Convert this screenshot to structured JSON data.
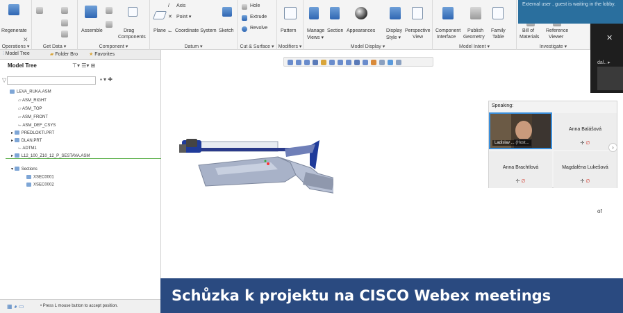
{
  "ribbon": {
    "groups": [
      {
        "label": "Operations ▾"
      },
      {
        "label": "Get Data ▾"
      },
      {
        "label": "Component ▾"
      },
      {
        "label": "Datum ▾"
      },
      {
        "label": "Cut & Surface ▾"
      },
      {
        "label": "Modifiers ▾"
      },
      {
        "label": "Model Display ▾"
      },
      {
        "label": "Model Intent ▾"
      },
      {
        "label": "Investigate ▾"
      }
    ],
    "buttons": {
      "regenerate": "Regenerate",
      "assemble": "Assemble",
      "drag_components_1": "Drag",
      "drag_components_2": "Components",
      "plane": "Plane",
      "axis": "Axis",
      "point": "Point ▾",
      "coordinate_system": "Coordinate System",
      "sketch": "Sketch",
      "hole": "Hole",
      "extrude": "Extrude",
      "revolve": "Revolve",
      "pattern": "Pattern",
      "manage_views_1": "Manage",
      "manage_views_2": "Views ▾",
      "section": "Section",
      "appearances": "Appearances",
      "display_style_1": "Display",
      "display_style_2": "Style ▾",
      "perspective_view_1": "Perspective",
      "perspective_view_2": "View",
      "component_interface_1": "Component",
      "component_interface_2": "Interface",
      "publish_geometry_1": "Publish",
      "publish_geometry_2": "Geometry",
      "family_table_1": "Family",
      "family_table_2": "Table",
      "bill_of_materials_1": "Bill of",
      "bill_of_materials_2": "Materials",
      "reference_viewer_1": "Reference",
      "reference_viewer_2": "Viewer"
    }
  },
  "notification": {
    "text": "External user , guest is waiting in the lobby."
  },
  "left_panel": {
    "tabs": {
      "model_tree": "Model Tree",
      "folder_browser": "Folder Bro",
      "favorites": "Favorites"
    },
    "header": "Model Tree",
    "tree": [
      {
        "label": "LEVA_RUKA.ASM"
      },
      {
        "label": "ASM_RIGHT"
      },
      {
        "label": "ASM_TOP"
      },
      {
        "label": "ASM_FRONT"
      },
      {
        "label": "ASM_DEF_CSYS"
      },
      {
        "label": "PREDLOKTI.PRT"
      },
      {
        "label": "DLAN.PRT"
      },
      {
        "label": "ADTM1"
      },
      {
        "label": "L12_100_Z10_12_P_SESTAVA.ASM"
      },
      {
        "label": "Sections"
      },
      {
        "label": "XSEC0001"
      },
      {
        "label": "XSEC0002"
      }
    ],
    "status": "• Press L mouse button to accept position."
  },
  "webex": {
    "speaking_label": "Speaking:",
    "active_speaker": {
      "name": "Ladislav ...",
      "role": "(Host..."
    },
    "participants": [
      {
        "name": "Anna Balášová"
      },
      {
        "name": "Anna Brachtlová"
      },
      {
        "name": "Magdaléna Lukešová"
      }
    ],
    "right_cut_text": "of"
  },
  "banner": {
    "text": "Schůzka k projektu na CISCO Webex meetings"
  },
  "colors": {
    "banner": "#2a4a80",
    "ribbon": "#f4f4f4",
    "notification": "#2a6f9e",
    "model_blue": "#1f3b9a",
    "model_gray": "#a7b0c4"
  }
}
